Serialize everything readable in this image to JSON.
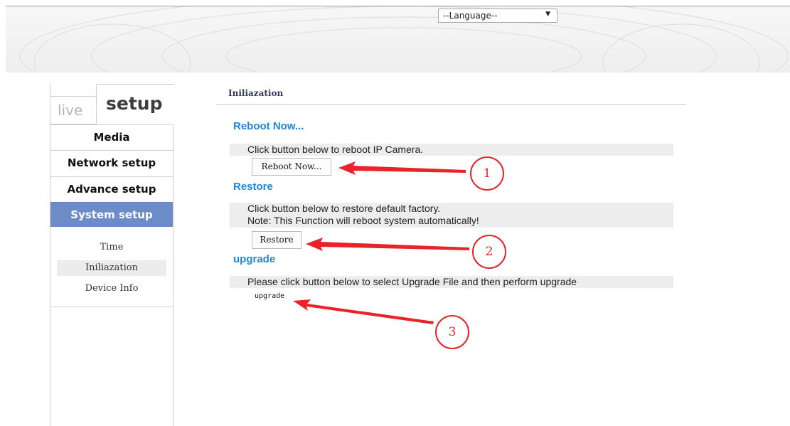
{
  "header": {
    "language_select": {
      "value": "--Language--"
    }
  },
  "nav": {
    "tabs": {
      "live": "live",
      "setup": "setup"
    },
    "items": [
      {
        "label": "Media"
      },
      {
        "label": "Network setup"
      },
      {
        "label": "Advance setup"
      },
      {
        "label": "System setup"
      }
    ],
    "sub_items": [
      {
        "label": "Time"
      },
      {
        "label": "Iniliazation"
      },
      {
        "label": "Device Info"
      }
    ],
    "active_item": "System setup",
    "selected_sub_item": "Iniliazation"
  },
  "main": {
    "title": "Iniliazation",
    "reboot": {
      "heading": "Reboot Now...",
      "description": "Click button below to reboot IP Camera.",
      "button_label": "Reboot Now..."
    },
    "restore": {
      "heading": "Restore",
      "description_line1": "Click button below to restore default factory.",
      "description_line2": "Note: This Function will reboot system automatically!",
      "button_label": "Restore"
    },
    "upgrade": {
      "heading": "upgrade",
      "description": "Please click button below to select Upgrade File and then perform upgrade",
      "link_label": "upgrade"
    }
  },
  "annotations": [
    {
      "number": "1"
    },
    {
      "number": "2"
    },
    {
      "number": "3"
    }
  ],
  "colors": {
    "accent": "#1e87d6",
    "nav_active": "#6c8cc8",
    "annotation": "#e8232a"
  }
}
